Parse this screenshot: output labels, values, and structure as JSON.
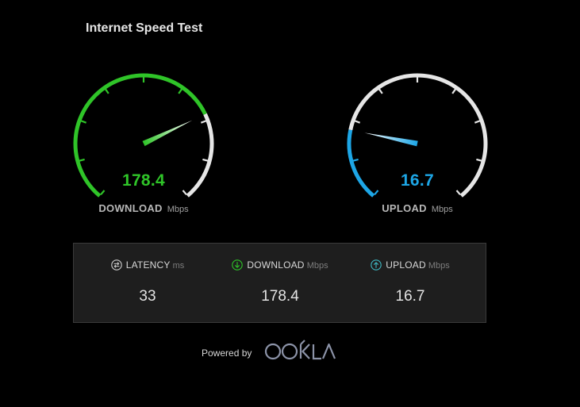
{
  "page": {
    "title": "Internet Speed Test"
  },
  "gauges": {
    "download": {
      "value": "178.4",
      "label": "DOWNLOAD",
      "unit": "Mbps",
      "fill_fraction": 0.73,
      "color": "#2fc428"
    },
    "upload": {
      "value": "16.7",
      "label": "UPLOAD",
      "unit": "Mbps",
      "fill_fraction": 0.22,
      "color": "#1da6e6"
    }
  },
  "results": {
    "latency": {
      "icon": "swap-arrows-icon",
      "label": "LATENCY",
      "unit": "ms",
      "value": "33"
    },
    "download": {
      "icon": "download-arrow-icon",
      "label": "DOWNLOAD",
      "unit": "Mbps",
      "value": "178.4",
      "icon_color": "#2fc428"
    },
    "upload": {
      "icon": "upload-arrow-icon",
      "label": "UPLOAD",
      "unit": "Mbps",
      "value": "16.7",
      "icon_color": "#3fb8c2"
    }
  },
  "footer": {
    "powered_by": "Powered by",
    "brand": "OOKLA"
  },
  "colors": {
    "background": "#000000",
    "panel": "#1e1e1e",
    "track": "#e6e6e6"
  }
}
